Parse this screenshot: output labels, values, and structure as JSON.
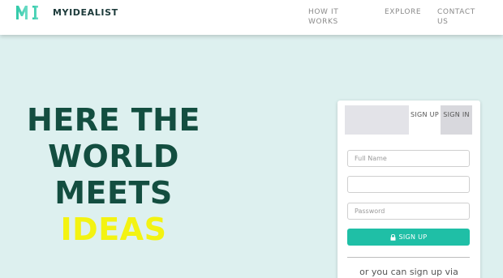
{
  "header": {
    "logo_text": "MI",
    "brand": "MYIDEALIST",
    "nav": {
      "how_it_works": "HOW IT WORKS",
      "explore": "EXPLORE",
      "contact_us": "CONTACT US"
    }
  },
  "hero": {
    "line1": "HERE THE",
    "line2": "WORLD",
    "line3": "MEETS",
    "highlight": "IDEAS"
  },
  "signup_card": {
    "tabs": {
      "sign_up": "SIGN UP",
      "sign_in": "SIGN IN"
    },
    "fields": {
      "full_name_placeholder": "Full Name",
      "email_placeholder": "",
      "password_placeholder": "Password"
    },
    "submit_label": "SIGN UP",
    "alt_text": "or you can sign up via"
  },
  "colors": {
    "accent": "#1fbfa6",
    "hero_text": "#134e40",
    "highlight": "#f3f312",
    "background": "#ddf0ef"
  },
  "icons": {
    "logo": "mi-logo-icon",
    "submit": "lock-icon"
  }
}
